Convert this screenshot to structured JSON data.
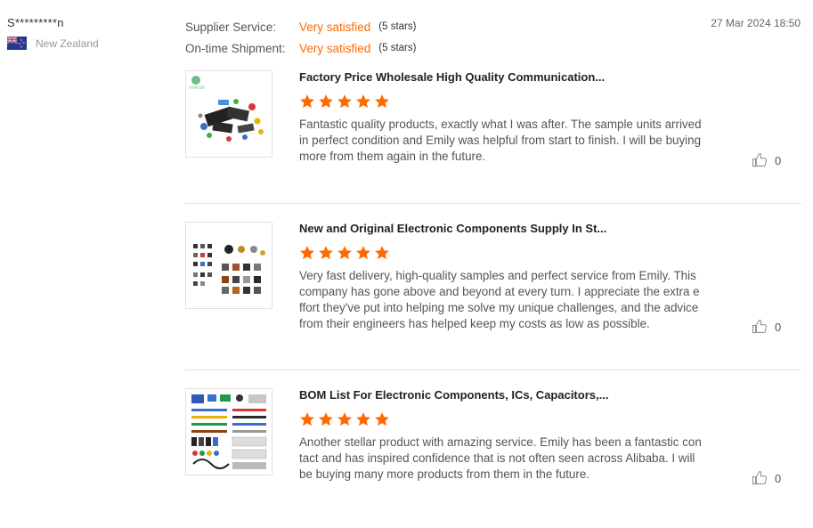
{
  "reviewer": {
    "name": "S*********n",
    "country": "New Zealand",
    "flag_icon": "new-zealand-flag-icon"
  },
  "ratings": [
    {
      "label": "Supplier Service:",
      "value": "Very satisfied",
      "stars": "(5 stars)"
    },
    {
      "label": "On-time Shipment:",
      "value": "Very satisfied",
      "stars": "(5 stars)"
    }
  ],
  "date": "27 Mar 2024 18:50",
  "reviews": [
    {
      "product_title": "Factory Price Wholesale High Quality Communication...",
      "rating": 5,
      "text": "Fantastic quality products, exactly what I was after. The sample units arrived in perfect condition and Emily was helpful from start to finish. I will be buying more from them again in the future.",
      "likes": "0",
      "thumb_label": "HAPCEN"
    },
    {
      "product_title": "New and Original Electronic Components Supply In St...",
      "rating": 5,
      "text": "Very fast delivery, high-quality samples and perfect service from Emily. This company has gone above and beyond at every turn. I appreciate the extra effort they've put into helping me solve my unique challenges, and the advice from their engineers has helped keep my costs as low as possible.",
      "likes": "0"
    },
    {
      "product_title": "BOM List For Electronic Components, ICs, Capacitors,...",
      "rating": 5,
      "text": "Another stellar product with amazing service. Emily has been a fantastic contact and has inspired confidence that is not often seen across Alibaba. I will be buying many more products from them in the future.",
      "likes": "0"
    }
  ],
  "colors": {
    "accent": "#ff6a00",
    "divider": "#e2e2e2"
  }
}
